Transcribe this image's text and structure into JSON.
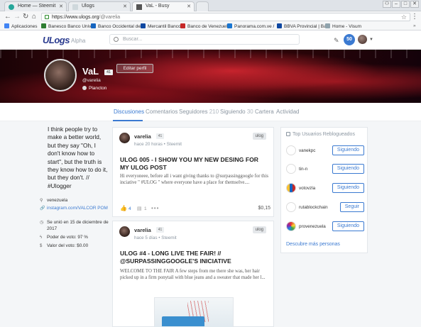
{
  "browser": {
    "tabs": [
      {
        "label": "Home — Steemit",
        "color": "#26a69a"
      },
      {
        "label": "Ulogs",
        "color": "#cfd8dc"
      },
      {
        "label": "VaL - Busy",
        "color": "#555555"
      }
    ],
    "url_main": "https://www.ulogs.org",
    "url_path": "/@varelia",
    "bookmarks": [
      {
        "label": "Aplicaciones",
        "color": "#4285f4"
      },
      {
        "label": "Banesco Banco Unive",
        "color": "#2e7d32"
      },
      {
        "label": "Banco Occidental de",
        "color": "#1565c0"
      },
      {
        "label": "Mercantil Banco",
        "color": "#0d47a1"
      },
      {
        "label": "Banco de Venezuela",
        "color": "#c62828"
      },
      {
        "label": "Panorama.com.ve /",
        "color": "#1976d2"
      },
      {
        "label": "BBVA Provincial | Ba",
        "color": "#0d47a1"
      },
      {
        "label": "Home - Visum",
        "color": "#90a4ae"
      }
    ]
  },
  "header": {
    "logo": "ULogs",
    "logo_suffix": "Alpha",
    "search_placeholder": "Buscar...",
    "notifications": "50",
    "accent": "#3b7ad1"
  },
  "profile": {
    "name": "VaL",
    "reputation": "41",
    "edit_label": "Editar perfil",
    "handle": "@varelia",
    "rank": "Plancton",
    "bio": "I think people try to make a better world, but they say \"Oh, I don't know how to start\", but the truth is they know how to do it, but they don't. // #Ulogger",
    "location": "venezuela",
    "link": "instagram.com/VALCOR POM",
    "joined": "Se unió en 15 de diciembre de 2017",
    "vote_power": "Poder de voto: 97 %",
    "vote_value": "Valor del voto: $0.00"
  },
  "tabs": [
    {
      "label": "Discusiones",
      "count": ""
    },
    {
      "label": "Comentarios",
      "count": ""
    },
    {
      "label": "Seguidores",
      "count": "210"
    },
    {
      "label": "Siguiendo",
      "count": "30"
    },
    {
      "label": "Cartera",
      "count": ""
    },
    {
      "label": "Actividad",
      "count": ""
    }
  ],
  "posts": [
    {
      "author": "varelia",
      "rep": "41",
      "time": "hace 20 horas",
      "source": "Steemit",
      "tag": "ulog",
      "title": "ULOG 005 - I SHOW YOU MY NEW DESING FOR MY ULOG POST",
      "excerpt": "Hi everyoneee, before all i want giving thanks to @surpassinggoogle for this inciative \" #ULOG \" where everyone have a place for themselve....",
      "votes": "4",
      "comments": "1",
      "payout": "$0,15"
    },
    {
      "author": "varelia",
      "rep": "41",
      "time": "hace 5 días",
      "source": "Steemit",
      "tag": "ulog",
      "title": "ULOG #4 - LONG LIVE THE FAIR! // @SURPASSINGGOOGLE'S INICIATIVE",
      "excerpt": "WELCOME TO THE FAIR A few steps from me there she was, her hair picked up in a firm ponytail with blue jeans and a sweater that made her l..."
    }
  ],
  "sidebar": {
    "title": "Top Usuarios Reblogueados",
    "users": [
      {
        "name": "vanekpc",
        "button": "Siguiendo"
      },
      {
        "name": "tin-n",
        "button": "Siguiendo"
      },
      {
        "name": "votovzla",
        "button": "Siguiendo"
      },
      {
        "name": "rutablockchain",
        "button": "Seguir"
      },
      {
        "name": "provenezuela",
        "button": "Siguiendo"
      }
    ],
    "more": "Descubre más personas"
  }
}
